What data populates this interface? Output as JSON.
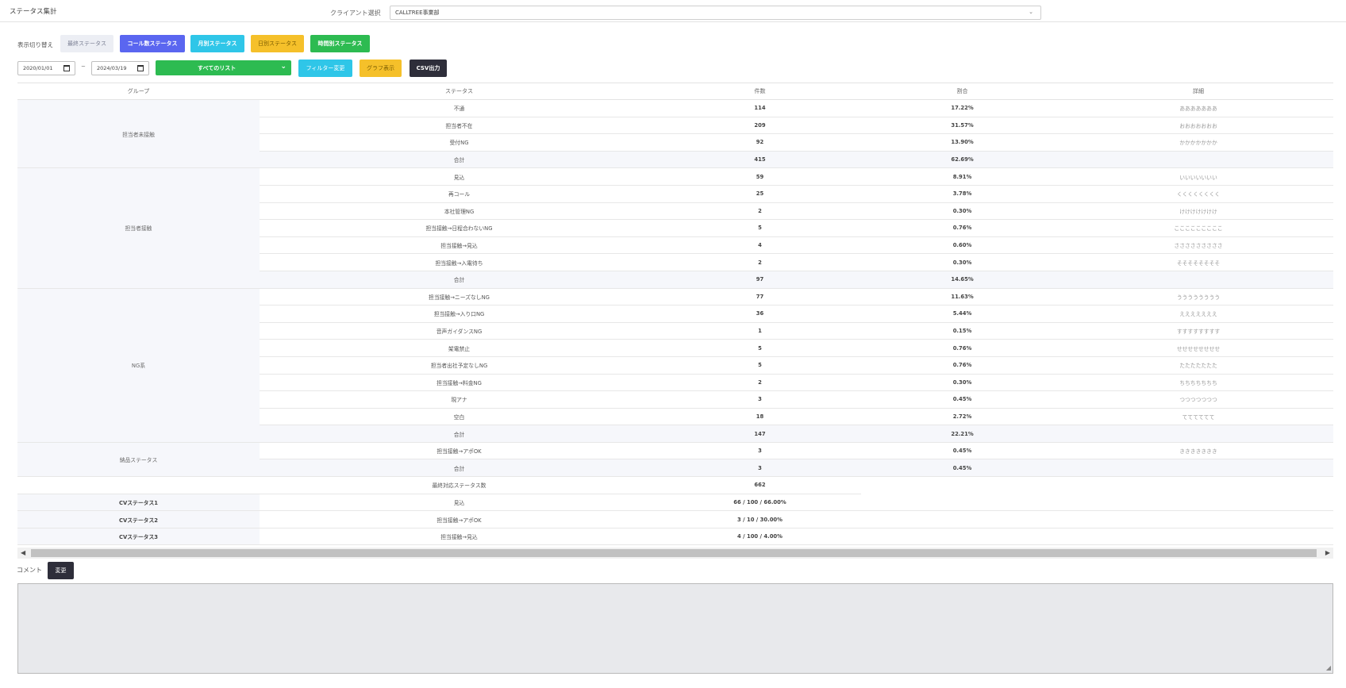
{
  "page_title": "ステータス集計",
  "client": {
    "label": "クライアント選択",
    "value": "CALLTREE事業部"
  },
  "view_switch": {
    "label": "表示切り替え",
    "buttons": [
      "最終ステータス",
      "コール数ステータス",
      "月別ステータス",
      "日別ステータス",
      "時間別ステータス"
    ]
  },
  "filters": {
    "date_from": "2020/01/01",
    "date_sep": "~",
    "date_to": "2024/03/19",
    "list_select": "すべてのリスト",
    "filter_button": "フィルター変更",
    "graph_button": "グラフ表示",
    "csv_button": "CSV出力"
  },
  "table": {
    "headers": [
      "グループ",
      "ステータス",
      "件数",
      "割合",
      "詳細"
    ],
    "groups": [
      {
        "name": "担当者未接触",
        "rows": [
          {
            "status": "不通",
            "count": "114",
            "ratio": "17.22%",
            "detail": "あああああああ"
          },
          {
            "status": "担当者不在",
            "count": "209",
            "ratio": "31.57%",
            "detail": "おおおおおおお"
          },
          {
            "status": "受付NG",
            "count": "92",
            "ratio": "13.90%",
            "detail": "かかかかかかか"
          }
        ],
        "total": {
          "label": "合計",
          "count": "415",
          "ratio": "62.69%"
        }
      },
      {
        "name": "担当者接触",
        "rows": [
          {
            "status": "見込",
            "count": "59",
            "ratio": "8.91%",
            "detail": "いいいいいいい"
          },
          {
            "status": "再コール",
            "count": "25",
            "ratio": "3.78%",
            "detail": "くくくくくくくく"
          },
          {
            "status": "本社管理NG",
            "count": "2",
            "ratio": "0.30%",
            "detail": "けけけけけけけ"
          },
          {
            "status": "担当接触→日程合わないNG",
            "count": "5",
            "ratio": "0.76%",
            "detail": "こここここここここ"
          },
          {
            "status": "担当接触→見込",
            "count": "4",
            "ratio": "0.60%",
            "detail": "さささささささささ"
          },
          {
            "status": "担当接触→入電待ち",
            "count": "2",
            "ratio": "0.30%",
            "detail": "そそそそそそそそ"
          }
        ],
        "total": {
          "label": "合計",
          "count": "97",
          "ratio": "14.65%"
        }
      },
      {
        "name": "NG系",
        "rows": [
          {
            "status": "担当接触→ニーズなしNG",
            "count": "77",
            "ratio": "11.63%",
            "detail": "うううううううう"
          },
          {
            "status": "担当接触→入り口NG",
            "count": "36",
            "ratio": "5.44%",
            "detail": "えええええええ"
          },
          {
            "status": "音声ガイダンスNG",
            "count": "1",
            "ratio": "0.15%",
            "detail": "すすすすすすすす"
          },
          {
            "status": "架電禁止",
            "count": "5",
            "ratio": "0.76%",
            "detail": "せせせせせせせせ"
          },
          {
            "status": "担当者出社予定なしNG",
            "count": "5",
            "ratio": "0.76%",
            "detail": "たたたたたたた"
          },
          {
            "status": "担当接触→料金NG",
            "count": "2",
            "ratio": "0.30%",
            "detail": "ちちちちちちち"
          },
          {
            "status": "現アナ",
            "count": "3",
            "ratio": "0.45%",
            "detail": "つつつつつつつ"
          },
          {
            "status": "空白",
            "count": "18",
            "ratio": "2.72%",
            "detail": "てててててて"
          }
        ],
        "total": {
          "label": "合計",
          "count": "147",
          "ratio": "22.21%"
        }
      },
      {
        "name": "納品ステータス",
        "rows": [
          {
            "status": "担当接触→アポOK",
            "count": "3",
            "ratio": "0.45%",
            "detail": "ききききききき"
          }
        ],
        "total": {
          "label": "合計",
          "count": "3",
          "ratio": "0.45%"
        }
      }
    ],
    "final_total": {
      "label": "最終対応ステータス数",
      "count": "662"
    },
    "cv_rows": [
      {
        "name": "CVステータス1",
        "status": "見込",
        "value": "66 / 100 / 66.00%"
      },
      {
        "name": "CVステータス2",
        "status": "担当接触→アポOK",
        "value": "3 / 10 / 30.00%"
      },
      {
        "name": "CVステータス3",
        "status": "担当接触→見込",
        "value": "4 / 100 / 4.00%"
      }
    ]
  },
  "comment": {
    "label": "コメント",
    "button": "変更",
    "text": ""
  },
  "colors": {
    "call_button": "#5a66f0",
    "month_button": "#2fc6e8",
    "day_button": "#f5c02a",
    "hour_button": "#2dbb51",
    "dark_button": "#2e2e3a"
  }
}
